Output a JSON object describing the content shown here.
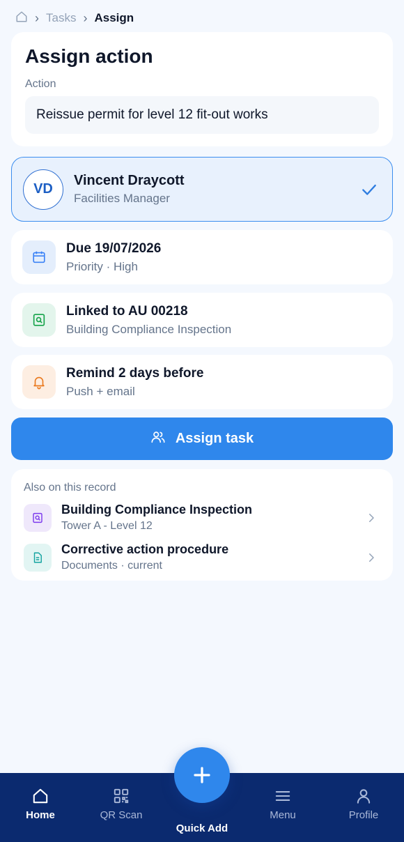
{
  "breadcrumb": {
    "home_icon": "home-icon",
    "items": [
      "Tasks",
      "Assign"
    ]
  },
  "action_card": {
    "title": "Assign action",
    "field_label": "Action",
    "field_value": "Reissue permit for level 12 fit-out works"
  },
  "assignee": {
    "initials": "VD",
    "name": "Vincent Draycott",
    "role": "Facilities Manager",
    "selected": true
  },
  "details": [
    {
      "icon": "calendar-icon",
      "title": "Due 19/07/2026",
      "subtitle": "Priority · High",
      "color": "#3b82f6"
    },
    {
      "icon": "inspection-icon",
      "title": "Linked to AU 00218",
      "subtitle": "Building Compliance Inspection",
      "color": "#16a34a"
    },
    {
      "icon": "bell-icon",
      "title": "Remind 2 days before",
      "subtitle": "Push + email",
      "color": "#ea7a1f"
    }
  ],
  "assign_button": {
    "label": "Assign task",
    "icon": "users-icon",
    "color": "#2f87ec"
  },
  "record": {
    "header": "Also on this record",
    "items": [
      {
        "icon": "inspection-icon",
        "title": "Building Compliance Inspection",
        "subtitle": "Tower A - Level 12"
      },
      {
        "icon": "document-icon",
        "title": "Corrective action procedure",
        "subtitle": "Documents · current"
      }
    ]
  },
  "bottom_nav": {
    "items": [
      {
        "label": "Home",
        "icon": "home-icon",
        "active": true
      },
      {
        "label": "QR Scan",
        "icon": "qr-icon",
        "active": false
      },
      {
        "label": "Menu",
        "icon": "menu-icon",
        "active": false
      },
      {
        "label": "Profile",
        "icon": "profile-icon",
        "active": false
      }
    ],
    "fab_label": "Quick Add",
    "fab_icon": "plus-icon",
    "background": "#0b2a6f"
  }
}
